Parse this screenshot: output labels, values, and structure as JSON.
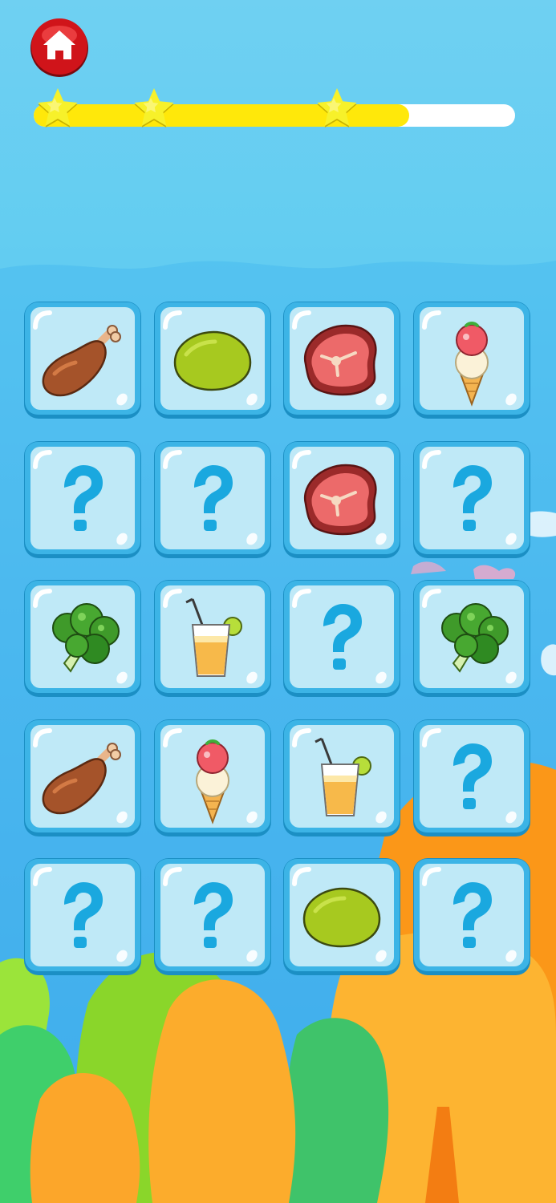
{
  "app": {
    "screen": "memory-match-game"
  },
  "header": {
    "home_button": {
      "icon": "home-icon"
    },
    "progress": {
      "value": 0.78,
      "stars_earned": 3,
      "star_positions": [
        0.05,
        0.25,
        0.63
      ]
    }
  },
  "board": {
    "rows": 5,
    "cols": 4,
    "cards": [
      {
        "state": "revealed",
        "item": "drumstick"
      },
      {
        "state": "revealed",
        "item": "lemon"
      },
      {
        "state": "revealed",
        "item": "steak"
      },
      {
        "state": "revealed",
        "item": "ice-cream"
      },
      {
        "state": "hidden",
        "item": "question"
      },
      {
        "state": "hidden",
        "item": "question"
      },
      {
        "state": "revealed",
        "item": "steak"
      },
      {
        "state": "hidden",
        "item": "question"
      },
      {
        "state": "revealed",
        "item": "broccoli"
      },
      {
        "state": "revealed",
        "item": "juice"
      },
      {
        "state": "hidden",
        "item": "question"
      },
      {
        "state": "revealed",
        "item": "broccoli"
      },
      {
        "state": "revealed",
        "item": "drumstick"
      },
      {
        "state": "revealed",
        "item": "ice-cream"
      },
      {
        "state": "revealed",
        "item": "juice"
      },
      {
        "state": "hidden",
        "item": "question"
      },
      {
        "state": "hidden",
        "item": "question"
      },
      {
        "state": "hidden",
        "item": "question"
      },
      {
        "state": "revealed",
        "item": "lemon"
      },
      {
        "state": "hidden",
        "item": "question"
      }
    ]
  },
  "colors": {
    "sky": "#63cdf1",
    "card_face": "#bfe9f7",
    "card_border": "#2aa9e0",
    "question_mark": "#1aa8df",
    "progress_fill": "#ffe80a",
    "progress_track": "#ffffff",
    "star": "#f7f12a",
    "home_button": "#d0141a"
  }
}
